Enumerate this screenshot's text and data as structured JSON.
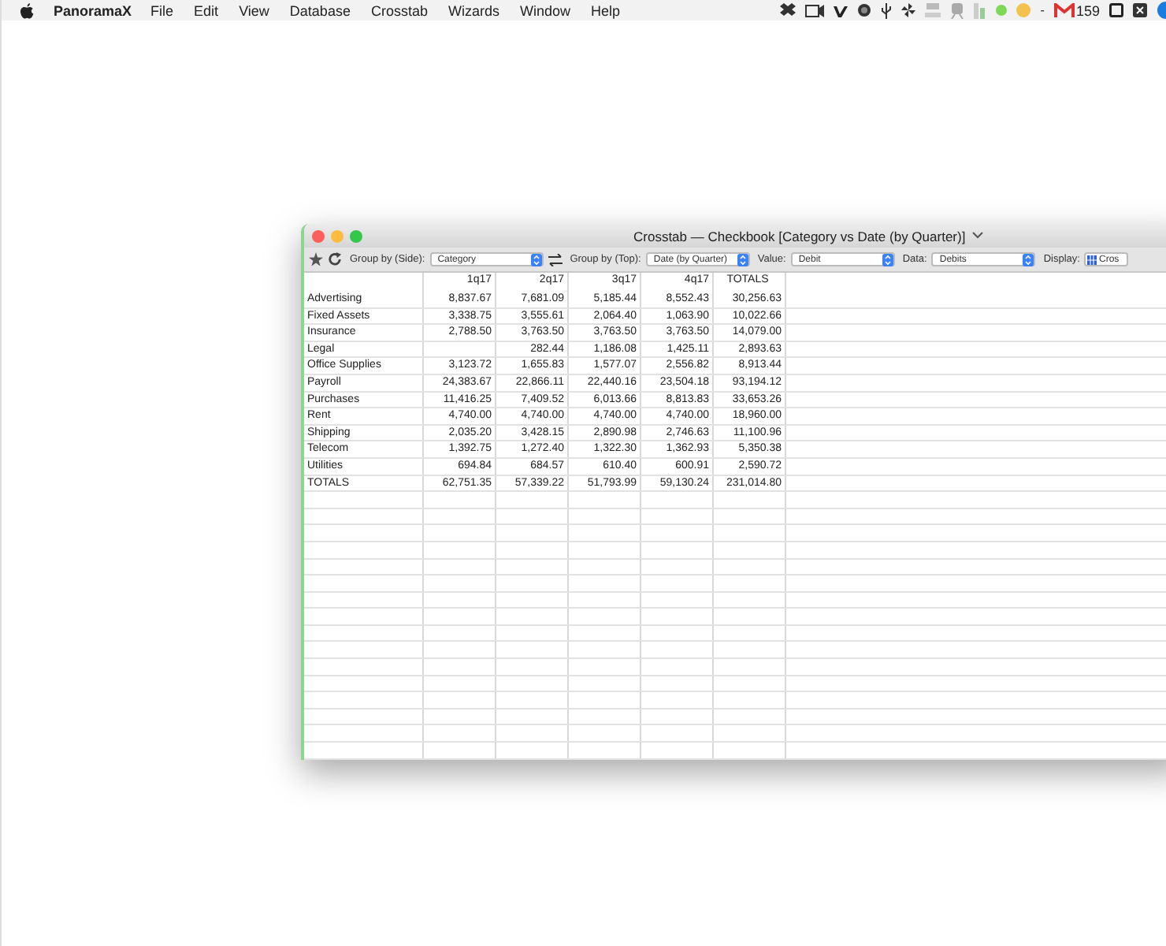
{
  "menubar": {
    "app_name": "PanoramaX",
    "items": [
      "File",
      "Edit",
      "View",
      "Database",
      "Crosstab",
      "Wizards",
      "Window",
      "Help"
    ],
    "status_dash": "-",
    "mail_count": "159"
  },
  "window": {
    "title": "Crosstab — Checkbook [Category vs Date (by Quarter)]",
    "toolbar": [
      {
        "label": "Group by (Side):",
        "value": "Category",
        "kind": "wide"
      },
      {
        "label": "Group by (Top):",
        "value": "Date (by Quarter)",
        "kind": "mid"
      },
      {
        "label": "Value:",
        "value": "Debit",
        "kind": "mid"
      },
      {
        "label": "Data:",
        "value": "Debits",
        "kind": "mid"
      },
      {
        "label": "Display:",
        "value": "Cros",
        "kind": "cut"
      }
    ],
    "table": {
      "columns": [
        "1q17",
        "2q17",
        "3q17",
        "4q17",
        "TOTALS"
      ],
      "rows": [
        {
          "label": "Advertising",
          "cells": [
            "8,837.67",
            "7,681.09",
            "5,185.44",
            "8,552.43",
            "30,256.63"
          ]
        },
        {
          "label": "Fixed Assets",
          "cells": [
            "3,338.75",
            "3,555.61",
            "2,064.40",
            "1,063.90",
            "10,022.66"
          ]
        },
        {
          "label": "Insurance",
          "cells": [
            "2,788.50",
            "3,763.50",
            "3,763.50",
            "3,763.50",
            "14,079.00"
          ]
        },
        {
          "label": "Legal",
          "cells": [
            null,
            "282.44",
            "1,186.08",
            "1,425.11",
            "2,893.63"
          ]
        },
        {
          "label": "Office Supplies",
          "cells": [
            "3,123.72",
            "1,655.83",
            "1,577.07",
            "2,556.82",
            "8,913.44"
          ]
        },
        {
          "label": "Payroll",
          "cells": [
            "24,383.67",
            "22,866.11",
            "22,440.16",
            "23,504.18",
            "93,194.12"
          ]
        },
        {
          "label": "Purchases",
          "cells": [
            "11,416.25",
            "7,409.52",
            "6,013.66",
            "8,813.83",
            "33,653.26"
          ]
        },
        {
          "label": "Rent",
          "cells": [
            "4,740.00",
            "4,740.00",
            "4,740.00",
            "4,740.00",
            "18,960.00"
          ]
        },
        {
          "label": "Shipping",
          "cells": [
            "2,035.20",
            "3,428.15",
            "2,890.98",
            "2,746.63",
            "11,100.96"
          ]
        },
        {
          "label": "Telecom",
          "cells": [
            "1,392.75",
            "1,272.40",
            "1,322.30",
            "1,362.93",
            "5,350.38"
          ]
        },
        {
          "label": "Utilities",
          "cells": [
            "694.84",
            "684.57",
            "610.40",
            "600.91",
            "2,590.72"
          ]
        },
        {
          "label": "TOTALS",
          "cells": [
            "62,751.35",
            "57,339.22",
            "51,793.99",
            "59,130.24",
            "231,014.80"
          ]
        }
      ]
    }
  }
}
